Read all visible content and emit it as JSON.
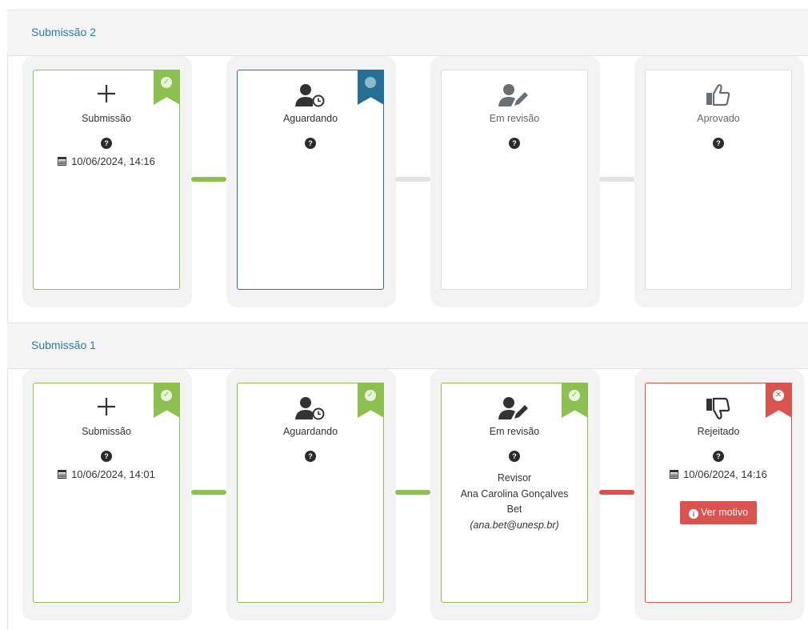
{
  "submissions": [
    {
      "title": "Submissão 2",
      "steps": [
        {
          "label": "Submissão",
          "status": "done",
          "ribbon_icon": "check-icon",
          "date": "10/06/2024, 14:16"
        },
        {
          "label": "Aguardando",
          "status": "current",
          "ribbon_icon": "circle-icon"
        },
        {
          "label": "Em revisão",
          "status": "pending"
        },
        {
          "label": "Aprovado",
          "status": "pending"
        }
      ],
      "connectors": [
        "green",
        "gray",
        "gray"
      ]
    },
    {
      "title": "Submissão 1",
      "steps": [
        {
          "label": "Submissão",
          "status": "done",
          "ribbon_icon": "check-icon",
          "date": "10/06/2024, 14:01"
        },
        {
          "label": "Aguardando",
          "status": "done",
          "ribbon_icon": "check-icon"
        },
        {
          "label": "Em revisão",
          "status": "done",
          "ribbon_icon": "check-icon",
          "reviewer_role": "Revisor",
          "reviewer_name_line1": "Ana Carolina Gonçalves",
          "reviewer_name_line2": "Bet",
          "reviewer_email": "(ana.bet@unesp.br)"
        },
        {
          "label": "Rejeitado",
          "status": "rejected",
          "ribbon_icon": "x-icon",
          "date": "10/06/2024, 14:16",
          "button_label": "Ver motivo"
        }
      ],
      "connectors": [
        "green",
        "green",
        "red"
      ]
    }
  ],
  "help_glyph": "?",
  "colors": {
    "done": "#8cc152",
    "current": "#246f94",
    "rejected": "#d9534f",
    "pending": "#dfe3e5",
    "title": "#2a7ba4"
  }
}
